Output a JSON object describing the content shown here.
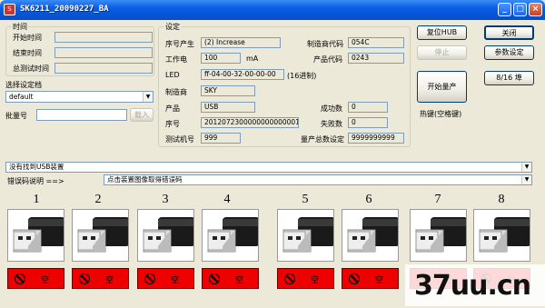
{
  "window": {
    "title": "SK6211_20090227_BA",
    "icon": "app-icon",
    "controls": {
      "minimize": "_",
      "maximize": "□",
      "close": "×"
    }
  },
  "time_group": {
    "title": "时间",
    "start_label": "开始时间",
    "end_label": "结束时间",
    "total_label": "总测试时间",
    "start_value": "",
    "end_value": "",
    "total_value": ""
  },
  "profile": {
    "label": "选择设定档",
    "selected": "default"
  },
  "batch": {
    "label": "批量号",
    "value": "",
    "load_button": "载入"
  },
  "settings": {
    "title": "设定",
    "serial_gen_label": "序号产生",
    "serial_gen_value": "(2) Increase",
    "vendor_code_label": "制造商代码",
    "vendor_code_value": "054C",
    "current_label": "工作电",
    "current_value": "100",
    "current_unit": "mA",
    "product_code_label": "产品代码",
    "product_code_value": "0243",
    "led_label": "LED",
    "led_value": "ff-04-00-32-00-00-00",
    "led_suffix": "(16进制)",
    "vendor_label": "制造商",
    "vendor_value": "SKY",
    "product_label": "产品",
    "product_value": "USB",
    "success_label": "成功数",
    "success_value": "0",
    "serial_label": "序号",
    "serial_value": "2012072300000000000001",
    "fail_label": "失败数",
    "fail_value": "0",
    "tester_label": "测试机号",
    "tester_value": "999",
    "total_label": "量产总数设定",
    "total_value": "9999999999"
  },
  "buttons": {
    "reset_hub": "复位HUB",
    "close": "关闭",
    "stop": "停止",
    "param_settings": "参数设定",
    "ports": "8/16 埠",
    "start": "开始量产",
    "hotkey": "热键(空格键)"
  },
  "status_bar": {
    "message": "没有找到USB装置"
  },
  "error": {
    "label": "错误码说明 ==>",
    "hint": "点击装置图像取得错误码"
  },
  "ports": [
    {
      "num": "1",
      "status": "空"
    },
    {
      "num": "2",
      "status": "空"
    },
    {
      "num": "3",
      "status": "空"
    },
    {
      "num": "4",
      "status": "空"
    },
    {
      "num": "5",
      "status": "空"
    },
    {
      "num": "6",
      "status": "空"
    },
    {
      "num": "7",
      "status": "空"
    },
    {
      "num": "8",
      "status": "空"
    }
  ],
  "watermark": "37uu.cn"
}
